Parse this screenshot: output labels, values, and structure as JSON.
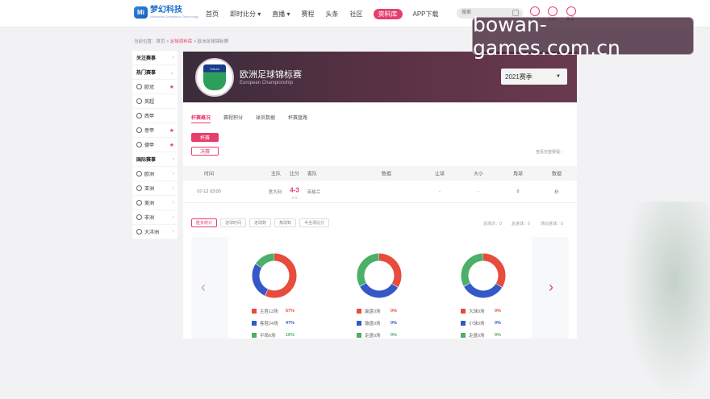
{
  "logo": {
    "mark": "Mi",
    "name": "梦幻科技",
    "sub": "Wonderful Dreamland Technology"
  },
  "nav": [
    "首页",
    "即时比分 ▾",
    "直播 ▾",
    "赛程",
    "头条",
    "社区",
    "资料库",
    "APP下载"
  ],
  "search_placeholder": "搜索",
  "top_icons": [
    {
      "label": ""
    },
    {
      "label": "注册"
    },
    {
      "label": "登录"
    }
  ],
  "watermark": "bowan-games.com.cn",
  "breadcrumb": {
    "prefix": "当前位置：首页 > ",
    "link": "足球资料库",
    "suffix": " > 欧洲足球锦标赛"
  },
  "sidebar": [
    {
      "label": "关注赛事",
      "type": "head",
      "mark": "›"
    },
    {
      "label": "热门赛事",
      "type": "head",
      "mark": "⌄"
    },
    {
      "label": "欧冠",
      "type": "item",
      "mark": "★"
    },
    {
      "label": "英超",
      "type": "item",
      "mark": ""
    },
    {
      "label": "西甲",
      "type": "item",
      "mark": ""
    },
    {
      "label": "意甲",
      "type": "item",
      "mark": "★"
    },
    {
      "label": "德甲",
      "type": "item",
      "mark": "★"
    },
    {
      "label": "国际赛事",
      "type": "head",
      "mark": "›"
    },
    {
      "label": "欧洲",
      "type": "item",
      "mark": "›"
    },
    {
      "label": "亚洲",
      "type": "item",
      "mark": "›"
    },
    {
      "label": "美洲",
      "type": "item",
      "mark": "›"
    },
    {
      "label": "非洲",
      "type": "item",
      "mark": "›"
    },
    {
      "label": "大洋洲",
      "type": "item",
      "mark": "›"
    }
  ],
  "banner": {
    "emblem_text": "ITALIA",
    "title": "欧洲足球锦标赛",
    "subtitle": "European Championship",
    "season": "2021赛季",
    "season_caret": "▼"
  },
  "tabs": [
    "杯赛概况",
    "赛程积分",
    "球员数据",
    "杯赛盘路"
  ],
  "buttons": {
    "cup": "杯赛",
    "final": "决赛"
  },
  "more_link": "查看完整赛程 ›",
  "table": {
    "headers": [
      "时间",
      "主队",
      "比分",
      "客队",
      "数据",
      "让球",
      "大小",
      "角球",
      "数据"
    ],
    "row": {
      "time": "07-12 03:00",
      "home": "意大利",
      "score": "4-3",
      "half": "1-1",
      "away": "英格兰",
      "data": "",
      "handicap": "-",
      "ou": "-",
      "corner": "8",
      "data2": "析"
    }
  },
  "subtabs": [
    "胜负统计",
    "进球时间",
    "进球数",
    "角球数",
    "半全场比分"
  ],
  "stat_links": [
    "总场次：0",
    "总进球：0",
    "场均进球：0"
  ],
  "donuts": [
    {
      "segments": [
        {
          "value": 57,
          "color": "#e74c3c"
        },
        {
          "value": 27,
          "color": "#3558c8"
        },
        {
          "value": 16,
          "color": "#4caf6a"
        }
      ],
      "legend": [
        {
          "label": "主胜13场",
          "pct": "57%",
          "color": "#e74c3c"
        },
        {
          "label": "客胜24场",
          "pct": "47%",
          "color": "#3558c8"
        },
        {
          "label": "平局6场",
          "pct": "16%",
          "color": "#4caf6a"
        }
      ]
    },
    {
      "segments": [
        {
          "value": 34,
          "color": "#e74c3c"
        },
        {
          "value": 33,
          "color": "#3558c8"
        },
        {
          "value": 33,
          "color": "#4caf6a"
        }
      ],
      "legend": [
        {
          "label": "赢盘0场",
          "pct": "0%",
          "color": "#e74c3c"
        },
        {
          "label": "输盘0场",
          "pct": "0%",
          "color": "#3558c8"
        },
        {
          "label": "走盘0场",
          "pct": "0%",
          "color": "#4caf6a"
        }
      ]
    },
    {
      "segments": [
        {
          "value": 34,
          "color": "#e74c3c"
        },
        {
          "value": 33,
          "color": "#3558c8"
        },
        {
          "value": 33,
          "color": "#4caf6a"
        }
      ],
      "legend": [
        {
          "label": "大球0场",
          "pct": "0%",
          "color": "#e74c3c"
        },
        {
          "label": "小球0场",
          "pct": "0%",
          "color": "#3558c8"
        },
        {
          "label": "走盘0场",
          "pct": "0%",
          "color": "#4caf6a"
        }
      ]
    }
  ],
  "arrows": {
    "prev": "‹",
    "next": "›"
  }
}
